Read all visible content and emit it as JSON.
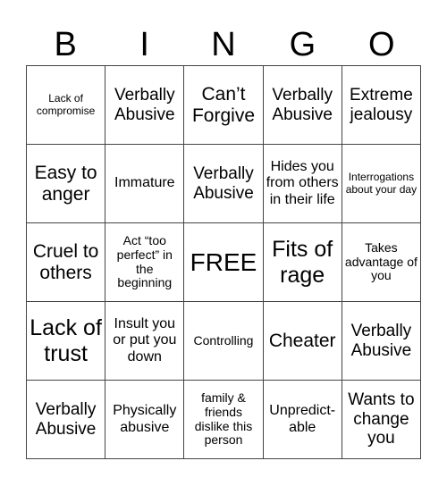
{
  "title": [
    "B",
    "I",
    "N",
    "G",
    "O"
  ],
  "rows": [
    [
      "Lack of compromise",
      "Verbally Abusive",
      "Can’t Forgive",
      "Verbally Abusive",
      "Extreme jealousy"
    ],
    [
      "Easy to anger",
      "Immature",
      "Verbally Abusive",
      "Hides you from others in their life",
      "Interrogations about your day"
    ],
    [
      "Cruel to others",
      "Act “too perfect” in the beginning",
      "FREE",
      "Fits of rage",
      "Takes advantage of you"
    ],
    [
      "Lack of trust",
      "Insult you or put you down",
      "Controlling",
      "Cheater",
      "Verbally Abusive"
    ],
    [
      "Verbally Abusive",
      "Physically abusive",
      "family & friends dislike this person",
      "Unpredict-able",
      "Wants to change you"
    ]
  ]
}
